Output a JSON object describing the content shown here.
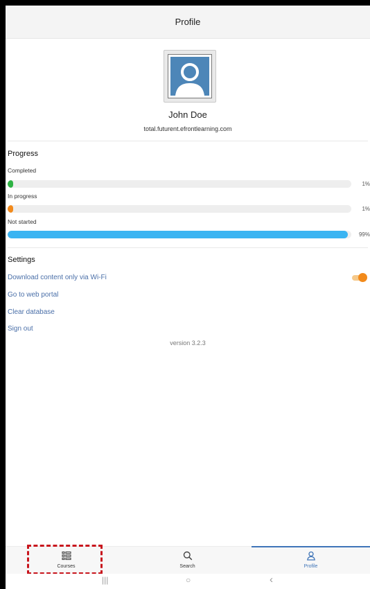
{
  "header": {
    "title": "Profile"
  },
  "user": {
    "name": "John Doe",
    "email": "total.futurent.efrontlearning.com"
  },
  "progress": {
    "title": "Progress",
    "items": [
      {
        "label": "Completed",
        "percent_text": "1%",
        "value": 1,
        "color": "#2fb344"
      },
      {
        "label": "In progress",
        "percent_text": "1%",
        "value": 1,
        "color": "#f28a1b"
      },
      {
        "label": "Not started",
        "percent_text": "99%",
        "value": 99,
        "color": "#3ab4f2"
      }
    ]
  },
  "settings": {
    "title": "Settings",
    "wifi_label": "Download content only via Wi-Fi",
    "wifi_enabled": true,
    "portal_label": "Go to web portal",
    "clear_label": "Clear database",
    "signout_label": "Sign out"
  },
  "version": "version 3.2.3",
  "bottom_nav": {
    "items": [
      {
        "label": "Courses",
        "icon": "courses-icon"
      },
      {
        "label": "Search",
        "icon": "search-icon"
      },
      {
        "label": "Profile",
        "icon": "profile-icon",
        "active": true
      }
    ]
  },
  "system_nav": {
    "recents": "|||",
    "home": "○",
    "back": "‹"
  },
  "colors": {
    "accent": "#3f74b8",
    "link": "#4a6fa8",
    "toggle": "#f28a1b",
    "highlight": "#c8151d"
  }
}
